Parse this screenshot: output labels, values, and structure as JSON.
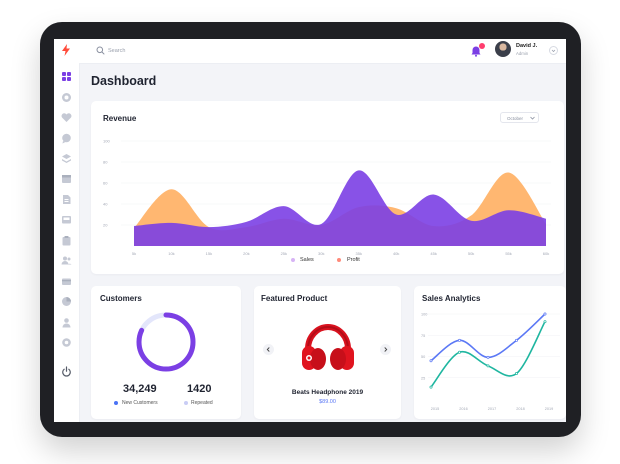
{
  "topbar": {
    "search_placeholder": "Search",
    "user": {
      "name": "David J.",
      "role": "Admin"
    }
  },
  "sidebar": {
    "icons": [
      "dashboard-icon",
      "analytics-icon",
      "heart-icon",
      "chat-icon",
      "layers-icon",
      "calendar-icon",
      "document-icon",
      "inbox-icon",
      "clipboard-icon",
      "users-icon",
      "card-icon",
      "chart-pie-icon",
      "user-icon",
      "settings-icon",
      "power-icon"
    ]
  },
  "page_title": "Dashboard",
  "revenue": {
    "title": "Revenue",
    "month_select": "October",
    "legend": {
      "sales": "Sales",
      "profit": "Profit"
    },
    "colors": {
      "sales": "#ffb369",
      "profit": "#7b3fe4"
    }
  },
  "customers": {
    "title": "Customers",
    "new_value": "34,249",
    "new_label": "New Customers",
    "repeated_value": "1420",
    "repeated_label": "Repeated",
    "colors": {
      "new": "#7b3fe4",
      "repeated": "#e3e6fb"
    }
  },
  "featured_product": {
    "title": "Featured Product",
    "name": "Beats Headphone 2019",
    "price": "$89.00"
  },
  "sales_analytics": {
    "title": "Sales Analytics"
  },
  "chart_data": [
    {
      "type": "area",
      "title": "Revenue",
      "x": [
        "5k",
        "10k",
        "15k",
        "20k",
        "25k",
        "30k",
        "35k",
        "40k",
        "45k",
        "50k",
        "55k",
        "60k"
      ],
      "ylim": [
        0,
        100
      ],
      "yticks": [
        "20",
        "40",
        "60",
        "80",
        "100"
      ],
      "series": [
        {
          "name": "Sales",
          "values": [
            17,
            54,
            18,
            18,
            26,
            20,
            37,
            36,
            19,
            29,
            70,
            21
          ]
        },
        {
          "name": "Profit",
          "values": [
            19,
            22,
            18,
            23,
            38,
            21,
            72,
            30,
            49,
            24,
            34,
            26
          ]
        }
      ],
      "legend_position": "bottom"
    },
    {
      "type": "pie",
      "title": "Customers",
      "series": [
        {
          "name": "New Customers",
          "values": [
            34249
          ]
        },
        {
          "name": "Repeated",
          "values": [
            1420
          ]
        }
      ]
    },
    {
      "type": "line",
      "title": "Sales Analytics",
      "x": [
        "2015",
        "2016",
        "2017",
        "2018",
        "2019"
      ],
      "ylim": [
        0,
        100
      ],
      "yticks": [
        "25",
        "50",
        "75",
        "100"
      ],
      "series": [
        {
          "name": "",
          "values": [
            45,
            69,
            49,
            69,
            100
          ]
        },
        {
          "name": "",
          "values": [
            14,
            55,
            39,
            30,
            91
          ]
        }
      ],
      "colors": [
        "#5b78f5",
        "#1fb6a0"
      ]
    }
  ]
}
